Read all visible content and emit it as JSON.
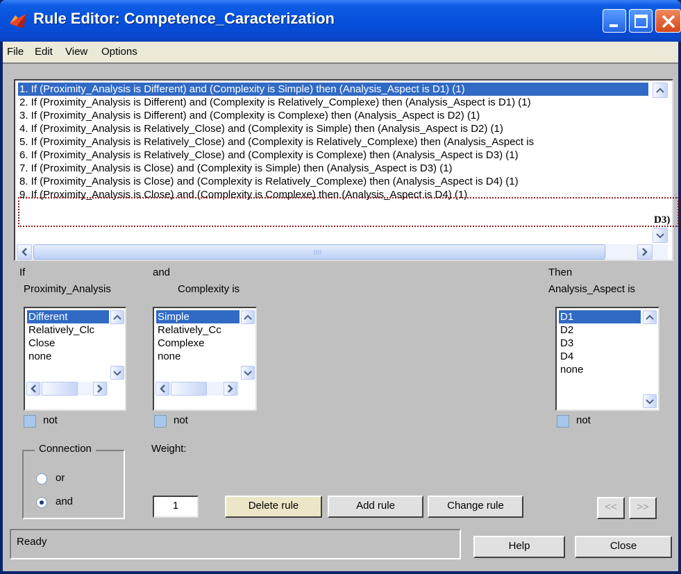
{
  "window": {
    "title": "Rule Editor: Competence_Caracterization"
  },
  "menu": [
    "File",
    "Edit",
    "View",
    "Options"
  ],
  "rules": [
    "1. If (Proximity_Analysis is Different) and (Complexity is Simple) then (Analysis_Aspect is D1) (1)",
    "2. If (Proximity_Analysis is Different) and (Complexity is Relatively_Complexe) then (Analysis_Aspect is D1) (1)",
    "3. If (Proximity_Analysis is Different) and (Complexity is Complexe) then (Analysis_Aspect is D2) (1)",
    "4. If (Proximity_Analysis is Relatively_Close) and (Complexity is Simple) then (Analysis_Aspect is D2) (1)",
    "5. If (Proximity_Analysis is Relatively_Close) and (Complexity is Relatively_Complexe) then (Analysis_Aspect is",
    "6. If (Proximity_Analysis is Relatively_Close) and (Complexity is Complexe) then (Analysis_Aspect is D3) (1)",
    "7. If (Proximity_Analysis is Close) and (Complexity is Simple) then (Analysis_Aspect is D3) (1)",
    "8. If (Proximity_Analysis is Close) and (Complexity is Relatively_Complexe) then (Analysis_Aspect is D4) (1)",
    "9. If (Proximity_Analysis is Close) and (Complexity is Complexe) then (Analysis_Aspect is D4) (1)"
  ],
  "annotation": "D3)",
  "if_section": {
    "label_if": "If",
    "variable": "Proximity_Analysis",
    "items": [
      "Different",
      "Relatively_Clc",
      "Close",
      "none"
    ],
    "not_label": "not"
  },
  "and_section": {
    "label_and": "and",
    "variable": "Complexity is",
    "items": [
      "Simple",
      "Relatively_Cc",
      "Complexe",
      "none"
    ],
    "not_label": "not"
  },
  "then_section": {
    "label_then": "Then",
    "variable": "Analysis_Aspect is",
    "items": [
      "D1",
      "D2",
      "D3",
      "D4",
      "none"
    ],
    "not_label": "not"
  },
  "connection": {
    "title": "Connection",
    "options": [
      "or",
      "and"
    ],
    "selected": "and"
  },
  "weight": {
    "label": "Weight:",
    "value": "1"
  },
  "buttons": {
    "delete": "Delete rule",
    "add": "Add rule",
    "change": "Change rule",
    "prev": "<<",
    "next": ">>",
    "help": "Help",
    "close": "Close"
  },
  "status": "Ready"
}
